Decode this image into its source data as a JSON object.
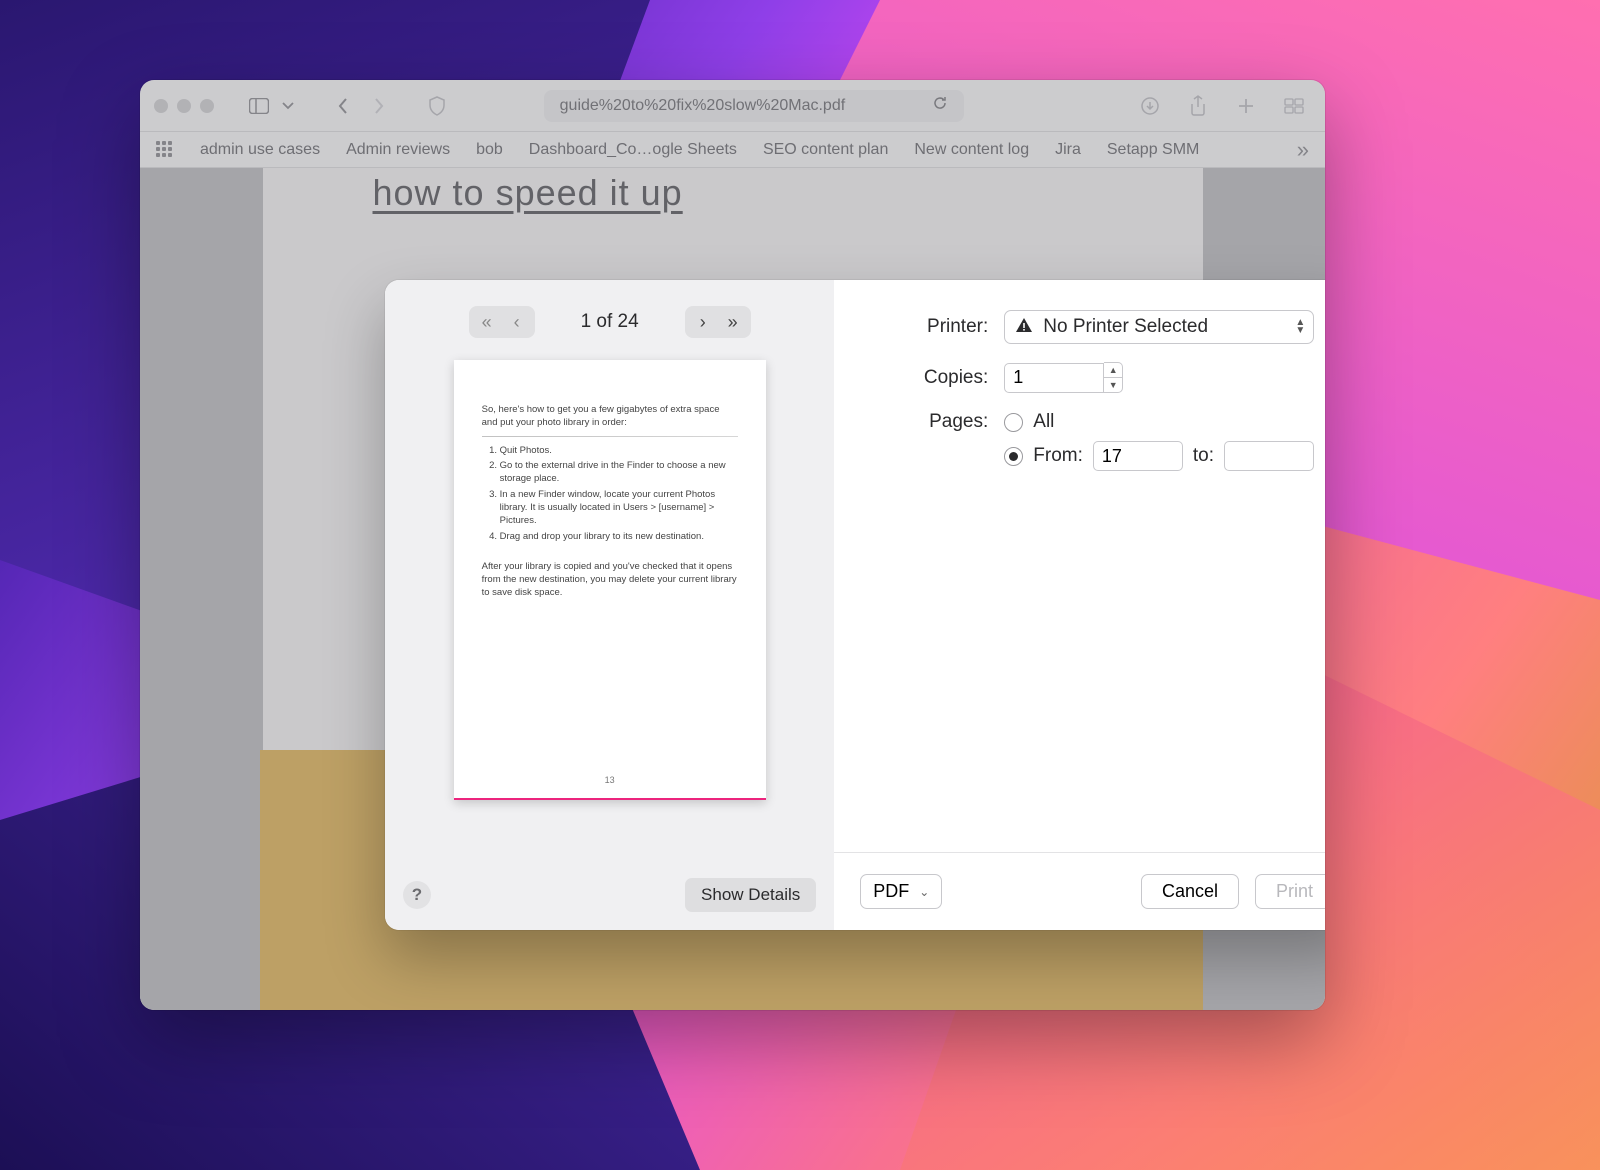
{
  "browser": {
    "url_display": "guide%20to%20fix%20slow%20Mac.pdf",
    "bookmarks": [
      "admin use cases",
      "Admin reviews",
      "bob",
      "Dashboard_Co…ogle Sheets",
      "SEO content plan",
      "New content log",
      "Jira",
      "Setapp SMM"
    ],
    "doc_heading": "how to speed it up"
  },
  "print": {
    "page_indicator": "1 of 24",
    "labels": {
      "printer": "Printer:",
      "copies": "Copies:",
      "pages": "Pages:",
      "all": "All",
      "from": "From:",
      "to": "to:"
    },
    "printer_value": "No Printer Selected",
    "copies_value": "1",
    "pages_selected": "from",
    "from_value": "17",
    "to_value": "",
    "show_details": "Show Details",
    "pdf_button": "PDF",
    "cancel": "Cancel",
    "print_button": "Print",
    "help_symbol": "?"
  },
  "preview": {
    "intro": "So, here's how to get you a few gigabytes of extra space and put your photo library in order:",
    "steps": [
      "Quit Photos.",
      "Go to the external drive in the Finder to choose a new storage place.",
      "In a new Finder window, locate your current Photos library. It is usually located in Users > [username] > Pictures.",
      "Drag and drop your library to its new destination."
    ],
    "outro": "After your library is copied and you've checked that it opens from the new destination, you may delete your current library to save disk space.",
    "page_num": "13"
  }
}
